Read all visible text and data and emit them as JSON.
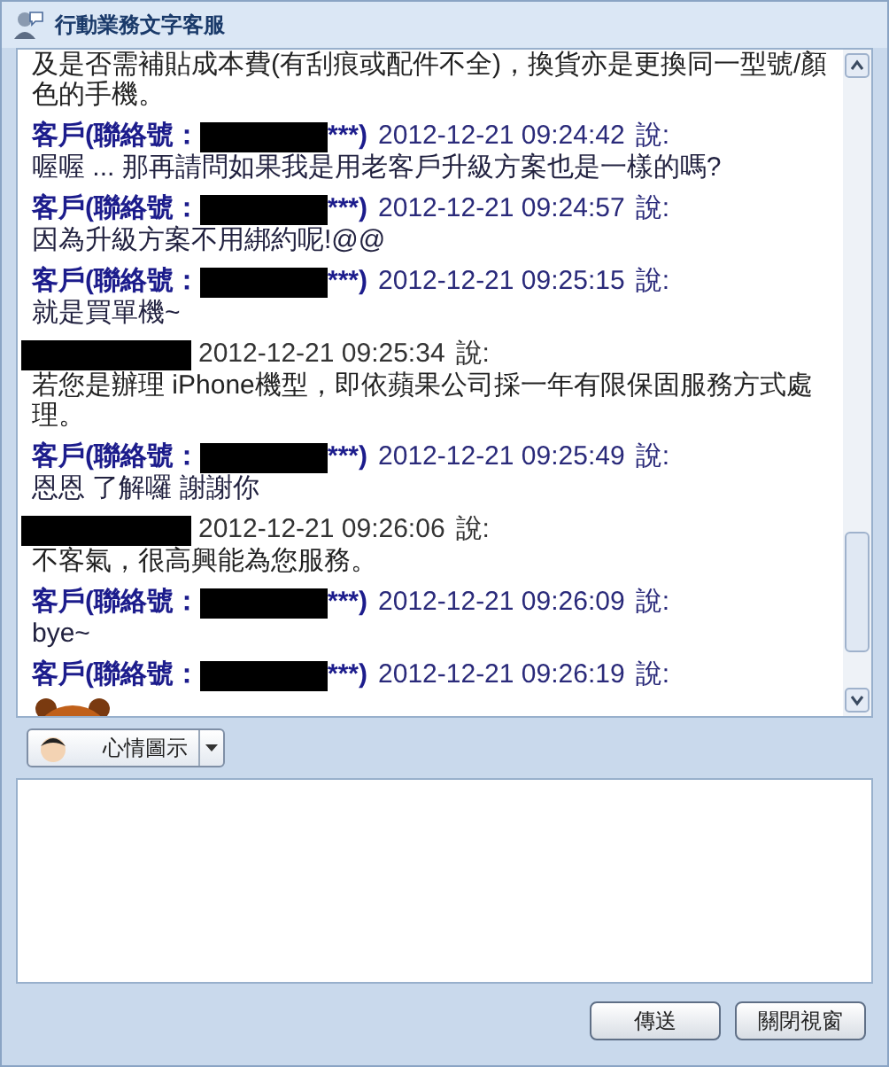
{
  "window": {
    "title": "行動業務文字客服"
  },
  "messages": [
    {
      "kind": "continuation",
      "text": "及是否需補貼成本費(有刮痕或配件不全)，換貨亦是更換同一型號/顏色的手機。"
    },
    {
      "kind": "customer",
      "label": "客戶(聯絡號：",
      "suffix": "***)",
      "time": "2012-12-21 09:24:42",
      "said": "說:",
      "text": "喔喔 ... 那再請問如果我是用老客戶升級方案也是一樣的嗎?"
    },
    {
      "kind": "customer",
      "label": "客戶(聯絡號：",
      "suffix": "***)",
      "time": "2012-12-21 09:24:57",
      "said": "說:",
      "text": "因為升級方案不用綁約呢!@@"
    },
    {
      "kind": "customer",
      "label": "客戶(聯絡號：",
      "suffix": "***)",
      "time": "2012-12-21 09:25:15",
      "said": "說:",
      "text": "就是買單機~"
    },
    {
      "kind": "agent",
      "time": "2012-12-21 09:25:34",
      "said": "說:",
      "text": "若您是辦理 iPhone機型，即依蘋果公司採一年有限保固服務方式處理。"
    },
    {
      "kind": "customer",
      "label": "客戶(聯絡號：",
      "suffix": "***)",
      "time": "2012-12-21 09:25:49",
      "said": "說:",
      "text": "恩恩 了解囉 謝謝你"
    },
    {
      "kind": "agent",
      "time": "2012-12-21 09:26:06",
      "said": "說:",
      "text": "不客氣，很高興能為您服務。"
    },
    {
      "kind": "customer",
      "label": "客戶(聯絡號：",
      "suffix": "***)",
      "time": "2012-12-21 09:26:09",
      "said": "說:",
      "text": "bye~"
    },
    {
      "kind": "customer",
      "label": "客戶(聯絡號：",
      "suffix": "***)",
      "time": "2012-12-21 09:26:19",
      "said": "說:",
      "sticker": true
    }
  ],
  "toolbar": {
    "mood_button": "心情圖示"
  },
  "buttons": [
    "傳送",
    "關閉視窗"
  ]
}
